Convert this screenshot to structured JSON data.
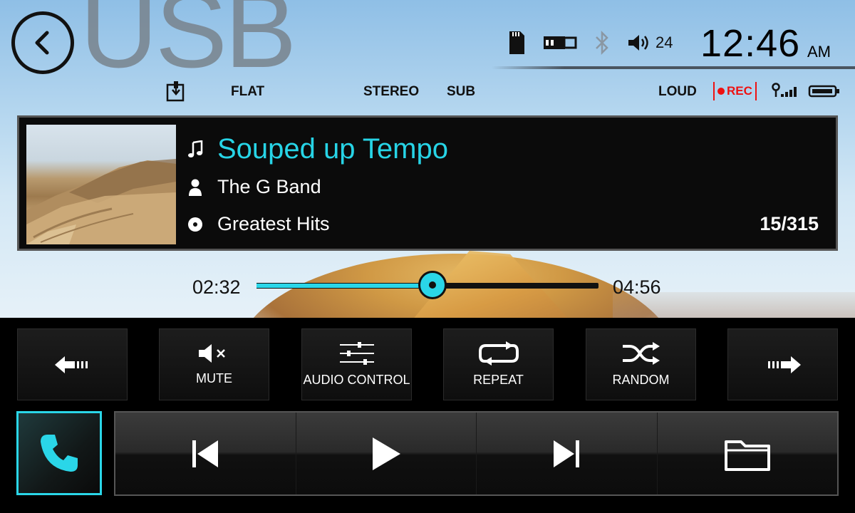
{
  "header": {
    "source_title": "USB",
    "volume": "24",
    "clock_time": "12:46",
    "clock_ampm": "AM",
    "eq_preset": "FLAT",
    "audio_mode": "STEREO",
    "sub_label": "SUB",
    "loud_label": "LOUD",
    "rec_label": "REC"
  },
  "now_playing": {
    "title": "Souped up Tempo",
    "artist": "The G Band",
    "album": "Greatest Hits",
    "track_count": "15/315"
  },
  "progress": {
    "elapsed": "02:32",
    "total": "04:56",
    "fraction": 0.514
  },
  "function_buttons": {
    "mute": "MUTE",
    "audio_control": "AUDIO CONTROL",
    "repeat": "REPEAT",
    "random": "RANDOM"
  },
  "colors": {
    "accent": "#2ad6e8",
    "title_text": "#27d4e6",
    "rec": "#e11111"
  },
  "icons": {
    "back": "back-arrow-icon",
    "sd_card": "sd-card-icon",
    "usb": "usb-icon",
    "bluetooth": "bluetooth-icon",
    "volume": "speaker-icon",
    "signal": "signal-icon",
    "battery": "battery-icon"
  }
}
